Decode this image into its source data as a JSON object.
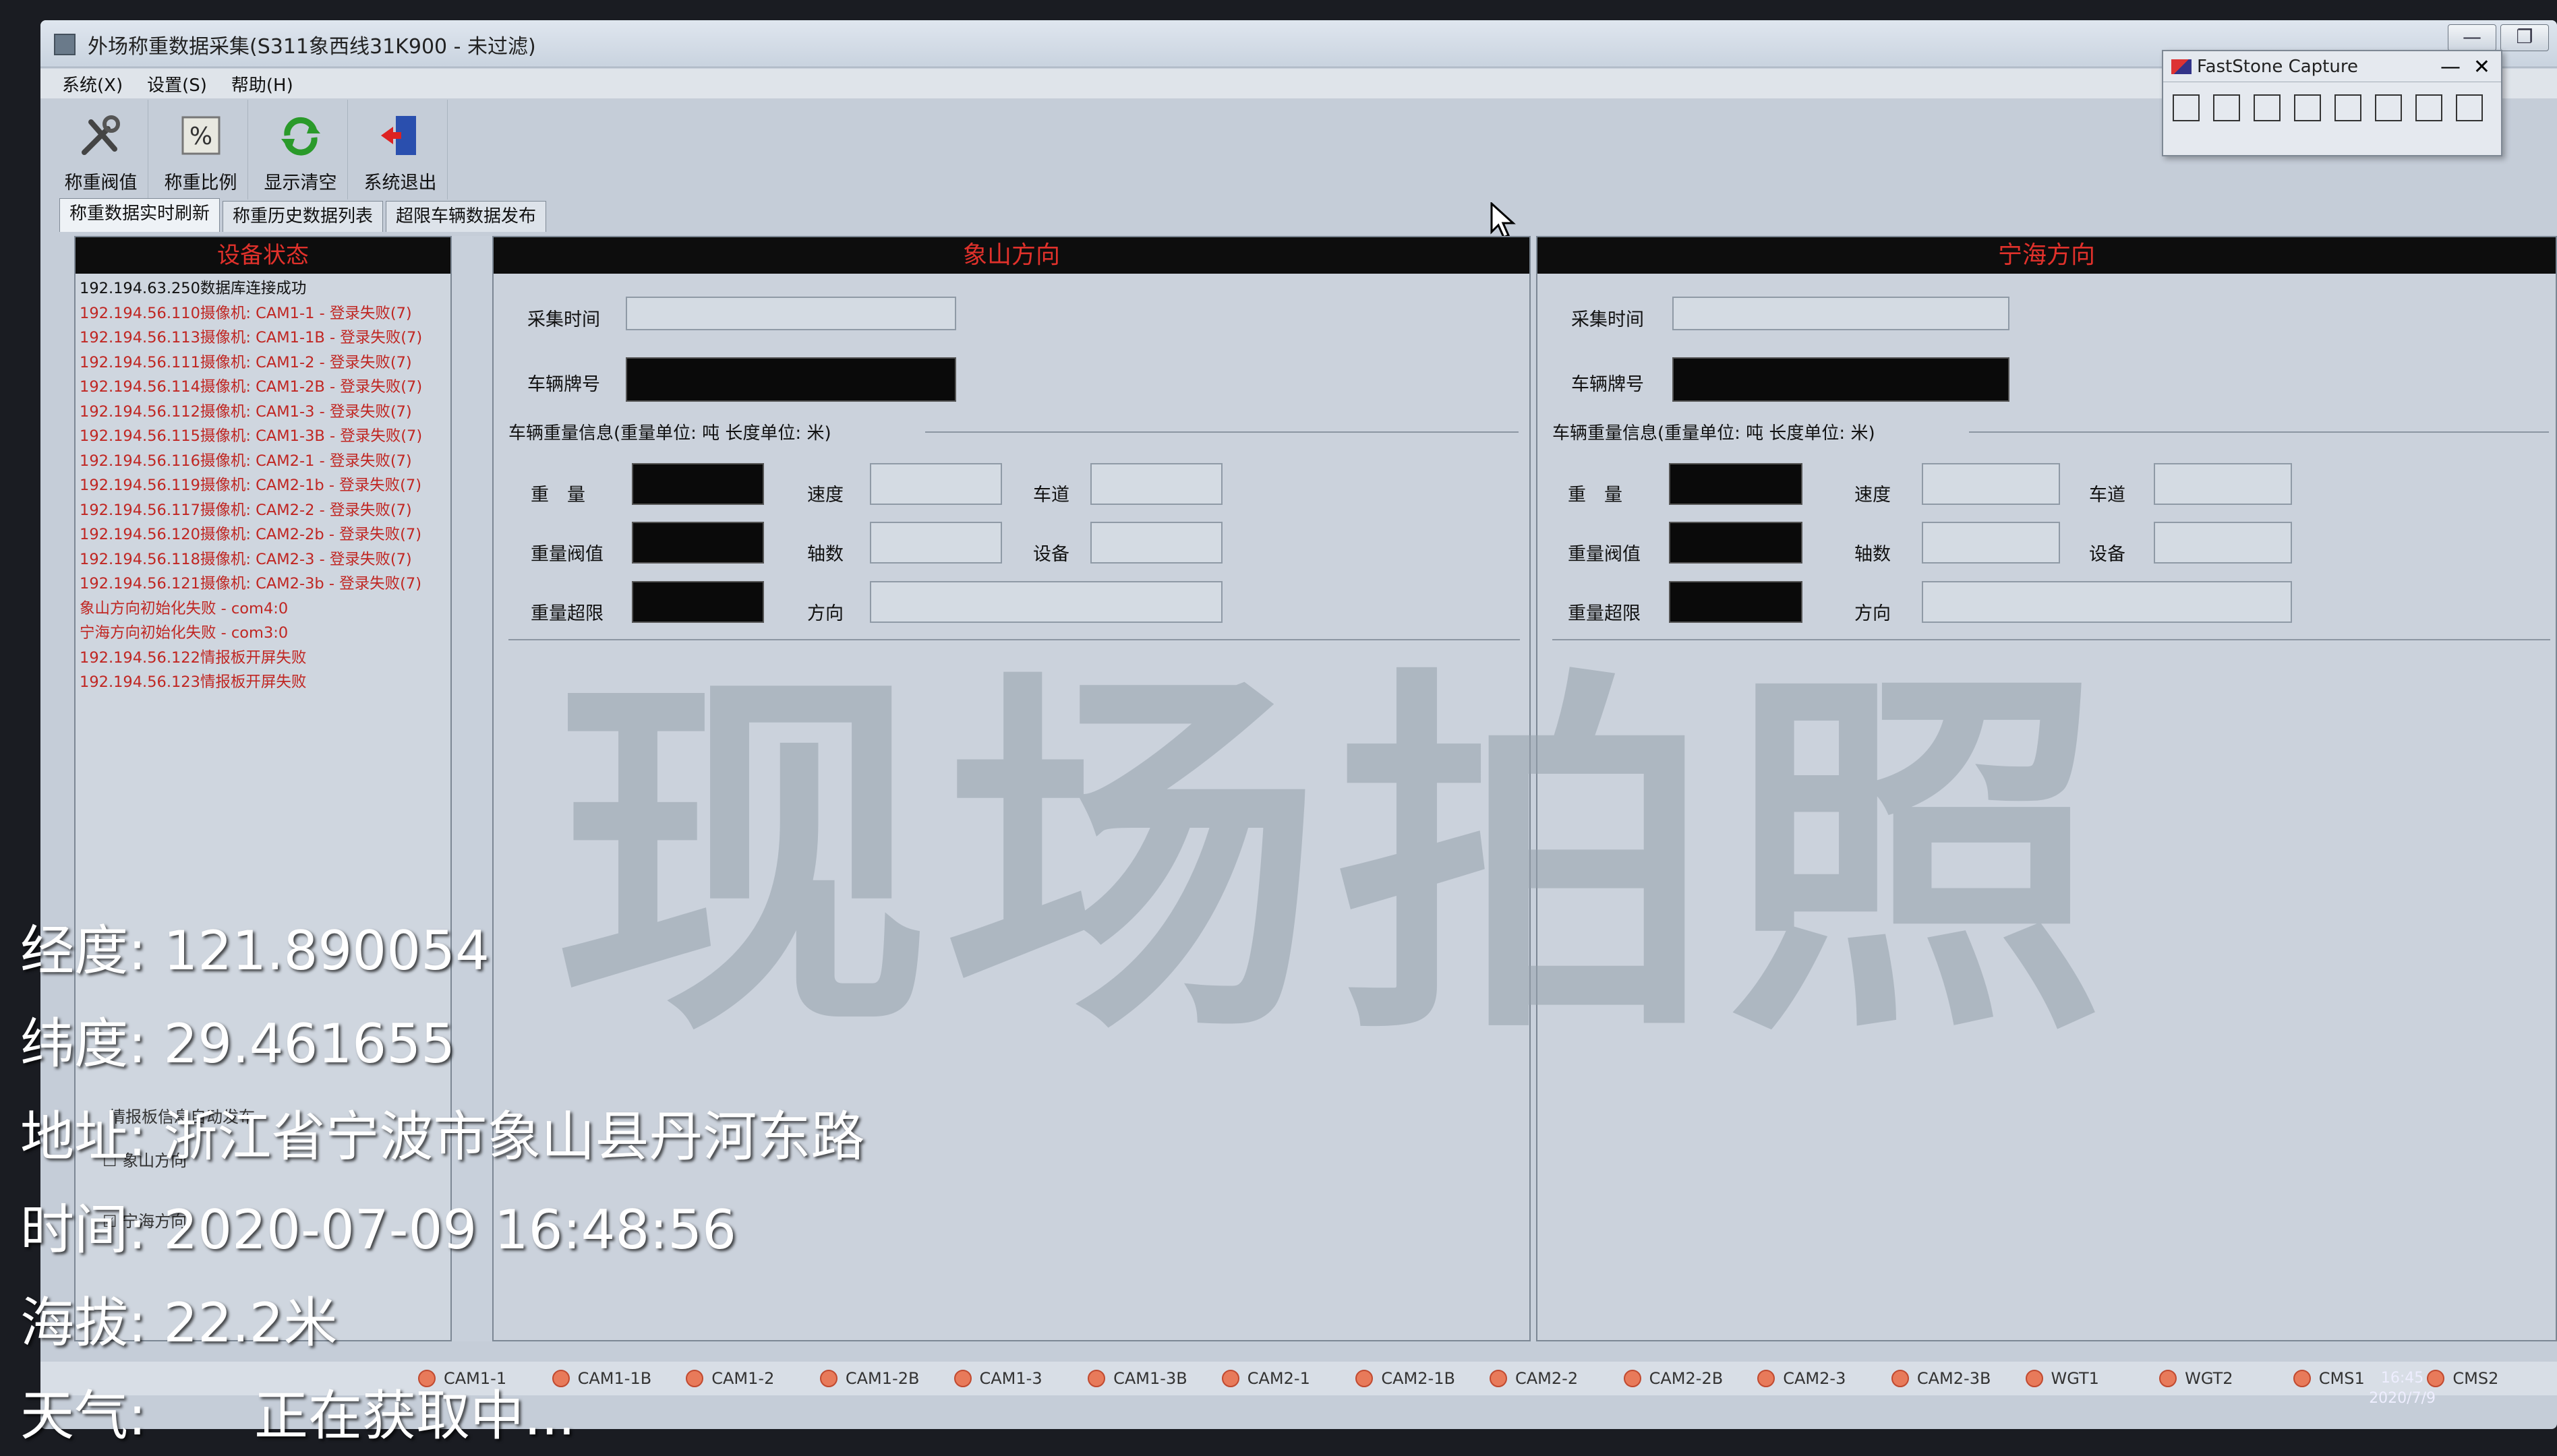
{
  "window": {
    "title": "外场称重数据采集(S311象西线31K900 - 未过滤)",
    "buttons": [
      "—",
      "❐"
    ]
  },
  "menu": [
    "系统(X)",
    "设置(S)",
    "帮助(H)"
  ],
  "toolbar": [
    {
      "label": "称重阀值",
      "icon": "wrench-icon"
    },
    {
      "label": "称重比例",
      "icon": "percent-icon"
    },
    {
      "label": "显示清空",
      "icon": "refresh-icon"
    },
    {
      "label": "系统退出",
      "icon": "exit-door-icon"
    }
  ],
  "tabs": [
    "称重数据实时刷新",
    "称重历史数据列表",
    "超限车辆数据发布"
  ],
  "faststone": {
    "title": "FastStone Capture",
    "min": "—",
    "close": "✕"
  },
  "device": {
    "title": "设备状态",
    "entries": [
      "192.194.63.250数据库连接成功",
      "192.194.56.110摄像机: CAM1-1 - 登录失败(7)",
      "192.194.56.113摄像机: CAM1-1B - 登录失败(7)",
      "192.194.56.111摄像机: CAM1-2 - 登录失败(7)",
      "192.194.56.114摄像机: CAM1-2B - 登录失败(7)",
      "192.194.56.112摄像机: CAM1-3 - 登录失败(7)",
      "192.194.56.115摄像机: CAM1-3B - 登录失败(7)",
      "192.194.56.116摄像机: CAM2-1 - 登录失败(7)",
      "192.194.56.119摄像机: CAM2-1b - 登录失败(7)",
      "192.194.56.117摄像机: CAM2-2 - 登录失败(7)",
      "192.194.56.120摄像机: CAM2-2b - 登录失败(7)",
      "192.194.56.118摄像机: CAM2-3 - 登录失败(7)",
      "192.194.56.121摄像机: CAM2-3b - 登录失败(7)",
      "象山方向初始化失败 - com4:0",
      "宁海方向初始化失败 - com3:0",
      "192.194.56.122情报板开屏失败",
      "192.194.56.123情报板开屏失败"
    ],
    "publish_label": "情报板信息自动发布",
    "chk1": "象山方向",
    "chk2": "宁海方向"
  },
  "directions": [
    {
      "title": "象山方向",
      "collect_time": "采集时间",
      "plate": "车辆牌号",
      "section": "车辆重量信息(重量单位: 吨 长度单位: 米)",
      "weight": "重　量",
      "speed": "速度",
      "lane": "车道",
      "threshold": "重量阀值",
      "axle": "轴数",
      "device": "设备",
      "overlimit": "重量超限",
      "direction": "方向"
    },
    {
      "title": "宁海方向",
      "collect_time": "采集时间",
      "plate": "车辆牌号",
      "section": "车辆重量信息(重量单位: 吨 长度单位: 米)",
      "weight": "重　量",
      "speed": "速度",
      "lane": "车道",
      "threshold": "重量阀值",
      "axle": "轴数",
      "device": "设备",
      "overlimit": "重量超限",
      "direction": "方向"
    }
  ],
  "status_cams": [
    "CAM1-1",
    "CAM1-1B",
    "CAM1-2",
    "CAM1-2B",
    "CAM1-3",
    "CAM1-3B",
    "CAM2-1",
    "CAM2-1B",
    "CAM2-2",
    "CAM2-2B",
    "CAM2-3",
    "CAM2-3B",
    "WGT1",
    "WGT2",
    "CMS1",
    "CMS2"
  ],
  "clock": {
    "time": "16:45",
    "date": "2020/7/9"
  },
  "watermark": "现场拍照",
  "overlay": {
    "lng": "经度: 121.890054",
    "lat": "纬度: 29.461655",
    "addr": "地址: 浙江省宁波市象山县丹河东路",
    "time": "时间: 2020-07-09 16:48:56",
    "alt": "海拔: 22.2米",
    "weather": "天气:　　正在获取中..."
  },
  "colors": {
    "header_red": "#e0312b",
    "error_red": "#c02622",
    "screen_bg": "#c5cdd8"
  }
}
